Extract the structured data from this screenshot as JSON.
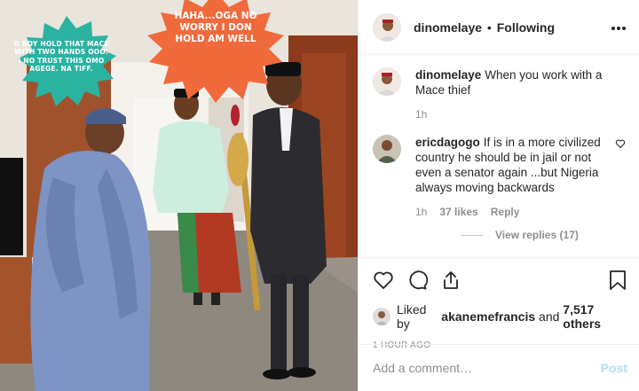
{
  "photo": {
    "burst_left": "O boy hold that mace with two hands ooo. I no trust this omo Agege. Na tiff.",
    "burst_right": "Haha...Oga no worry I don hold am well",
    "colors": {
      "burst_left": "#2bb3a2",
      "burst_right": "#f06a3c"
    }
  },
  "header": {
    "username": "dinomelaye",
    "separator": "•",
    "follow_status": "Following",
    "more_icon": "more-horizontal-icon"
  },
  "caption": {
    "username": "dinomelaye",
    "text": "When you work with a Mace thief",
    "time": "1h"
  },
  "comments": [
    {
      "username": "ericdagogo",
      "text": "If is in a more civilized country he should be in jail or not even a senator again ...but Nigeria always moving backwards",
      "time": "1h",
      "likes": "37 likes",
      "reply": "Reply"
    }
  ],
  "view_replies": "View replies (17)",
  "actions": {
    "icons": [
      "heart-icon",
      "comment-icon",
      "share-icon",
      "bookmark-icon"
    ]
  },
  "liked_by": {
    "prefix": "Liked by",
    "user": "akanemefrancis",
    "joiner": "and",
    "others": "7,517 others"
  },
  "post_time": "1 HOUR AGO",
  "add_comment": {
    "placeholder": "Add a comment…",
    "post_label": "Post"
  }
}
